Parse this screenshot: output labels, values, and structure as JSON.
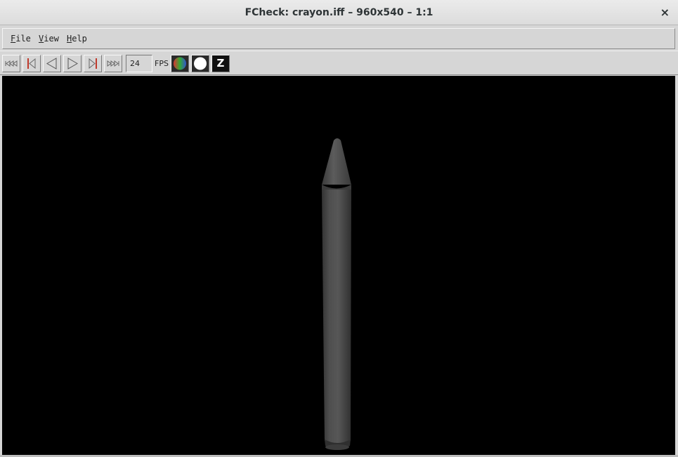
{
  "window": {
    "title": "FCheck: crayon.iff – 960x540 – 1:1",
    "close_glyph": "×"
  },
  "menu": {
    "items": [
      {
        "mnemonic": "F",
        "rest": "ile"
      },
      {
        "mnemonic": "V",
        "rest": "iew"
      },
      {
        "mnemonic": "H",
        "rest": "elp"
      }
    ]
  },
  "toolbar": {
    "fps_value": "24",
    "fps_label": "FPS",
    "icons": [
      "first-frame-icon",
      "prev-keyframe-icon",
      "play-backward-icon",
      "play-forward-icon",
      "next-keyframe-icon",
      "last-frame-icon",
      "rgb-channel-icon",
      "alpha-channel-icon",
      "z-depth-icon"
    ],
    "z_glyph": "Z"
  },
  "viewport": {
    "background": "#000000",
    "subject_color": "#4a4a4a"
  }
}
